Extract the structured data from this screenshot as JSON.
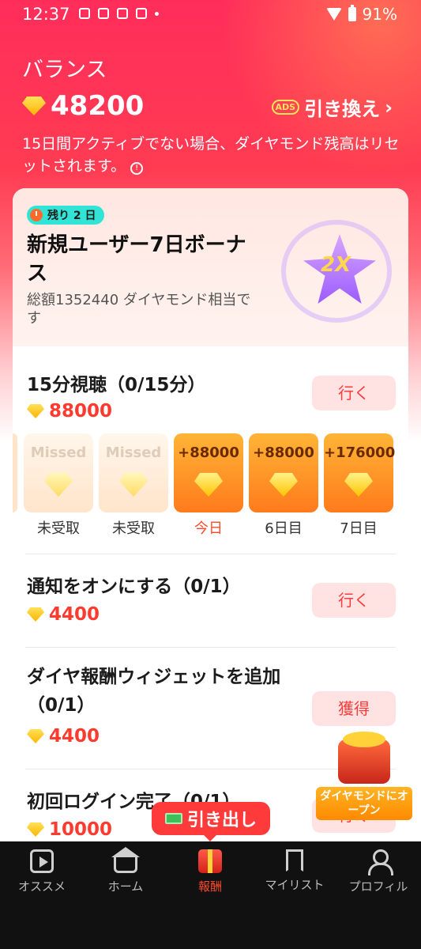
{
  "status_bar": {
    "time": "12:37",
    "battery": "91%"
  },
  "balance": {
    "label": "バランス",
    "amount": "48200",
    "exchange_label": "引き換え",
    "ads_badge": "ADS",
    "notice": "15日間アクティブでない場合、ダイヤモンド残高はリセットされます。"
  },
  "bonus": {
    "days_left": "残り 2 日",
    "title": "新規ユーザー7日ボーナス",
    "subtitle": "総額1352440 ダイヤモンド相当です",
    "multiplier": "2X"
  },
  "tasks": [
    {
      "title": "15分視聴（0/15分）",
      "reward": "88000",
      "button": "行く"
    },
    {
      "title": "通知をオンにする（0/1）",
      "reward": "4400",
      "button": "行く"
    },
    {
      "title": "ダイヤ報酬ウィジェットを追加（0/1）",
      "reward": "4400",
      "button": "獲得"
    },
    {
      "title": "初回ログイン完了（0/1）",
      "reward": "10000",
      "button": "行く"
    }
  ],
  "days": [
    {
      "value": "Missed",
      "label": "未受取",
      "state": "missed"
    },
    {
      "value": "Missed",
      "label": "未受取",
      "state": "missed"
    },
    {
      "value": "+88000",
      "label": "今日",
      "state": "today"
    },
    {
      "value": "+88000",
      "label": "6日目",
      "state": "upcoming"
    },
    {
      "value": "+176000",
      "label": "7日目",
      "state": "upcoming"
    }
  ],
  "chest": {
    "label": "ダイヤモンドにオープン"
  },
  "withdraw": {
    "label": "引き出し"
  },
  "nav": [
    {
      "label": "オススメ",
      "icon": "play-icon"
    },
    {
      "label": "ホーム",
      "icon": "home-icon"
    },
    {
      "label": "報酬",
      "icon": "gift-icon",
      "active": true
    },
    {
      "label": "マイリスト",
      "icon": "bookmark-icon"
    },
    {
      "label": "プロフィル",
      "icon": "person-icon"
    }
  ],
  "colors": {
    "accent": "#ff3b30",
    "hero_top": "#ff2d5a",
    "nav_bg": "#111111",
    "button_bg": "#ffe3e3"
  }
}
